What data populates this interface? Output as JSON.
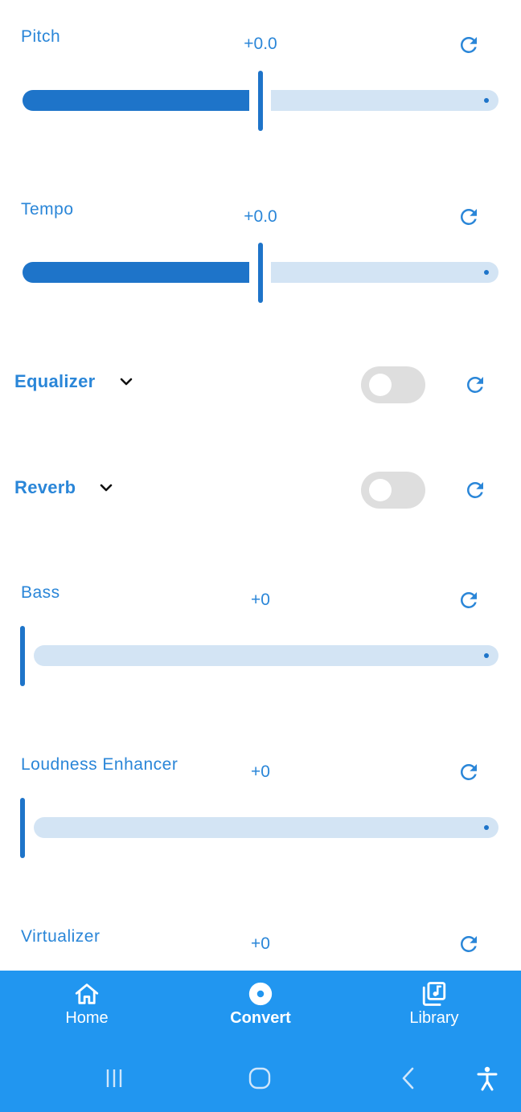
{
  "colors": {
    "accent": "#2a86d8",
    "track_active": "#1e74c9",
    "track_inactive": "#d3e4f4",
    "nav_bg": "#2196f0"
  },
  "pitch": {
    "label": "Pitch",
    "value": "+0.0",
    "position": 0.5
  },
  "tempo": {
    "label": "Tempo",
    "value": "+0.0",
    "position": 0.5
  },
  "equalizer": {
    "label": "Equalizer",
    "enabled": false
  },
  "reverb": {
    "label": "Reverb",
    "enabled": false
  },
  "bass": {
    "label": "Bass",
    "value": "+0",
    "position": 0
  },
  "loudness": {
    "label": "Loudness Enhancer",
    "value": "+0",
    "position": 0
  },
  "virtualizer": {
    "label": "Virtualizer",
    "value": "+0"
  },
  "bottom_nav": {
    "items": [
      {
        "label": "Home",
        "icon": "home-icon",
        "active": false
      },
      {
        "label": "Convert",
        "icon": "disc-icon",
        "active": true
      },
      {
        "label": "Library",
        "icon": "music-library-icon",
        "active": false
      }
    ]
  },
  "system_nav": {
    "icons": [
      "recent-apps-icon",
      "home-circle-icon",
      "back-icon",
      "accessibility-icon"
    ]
  }
}
